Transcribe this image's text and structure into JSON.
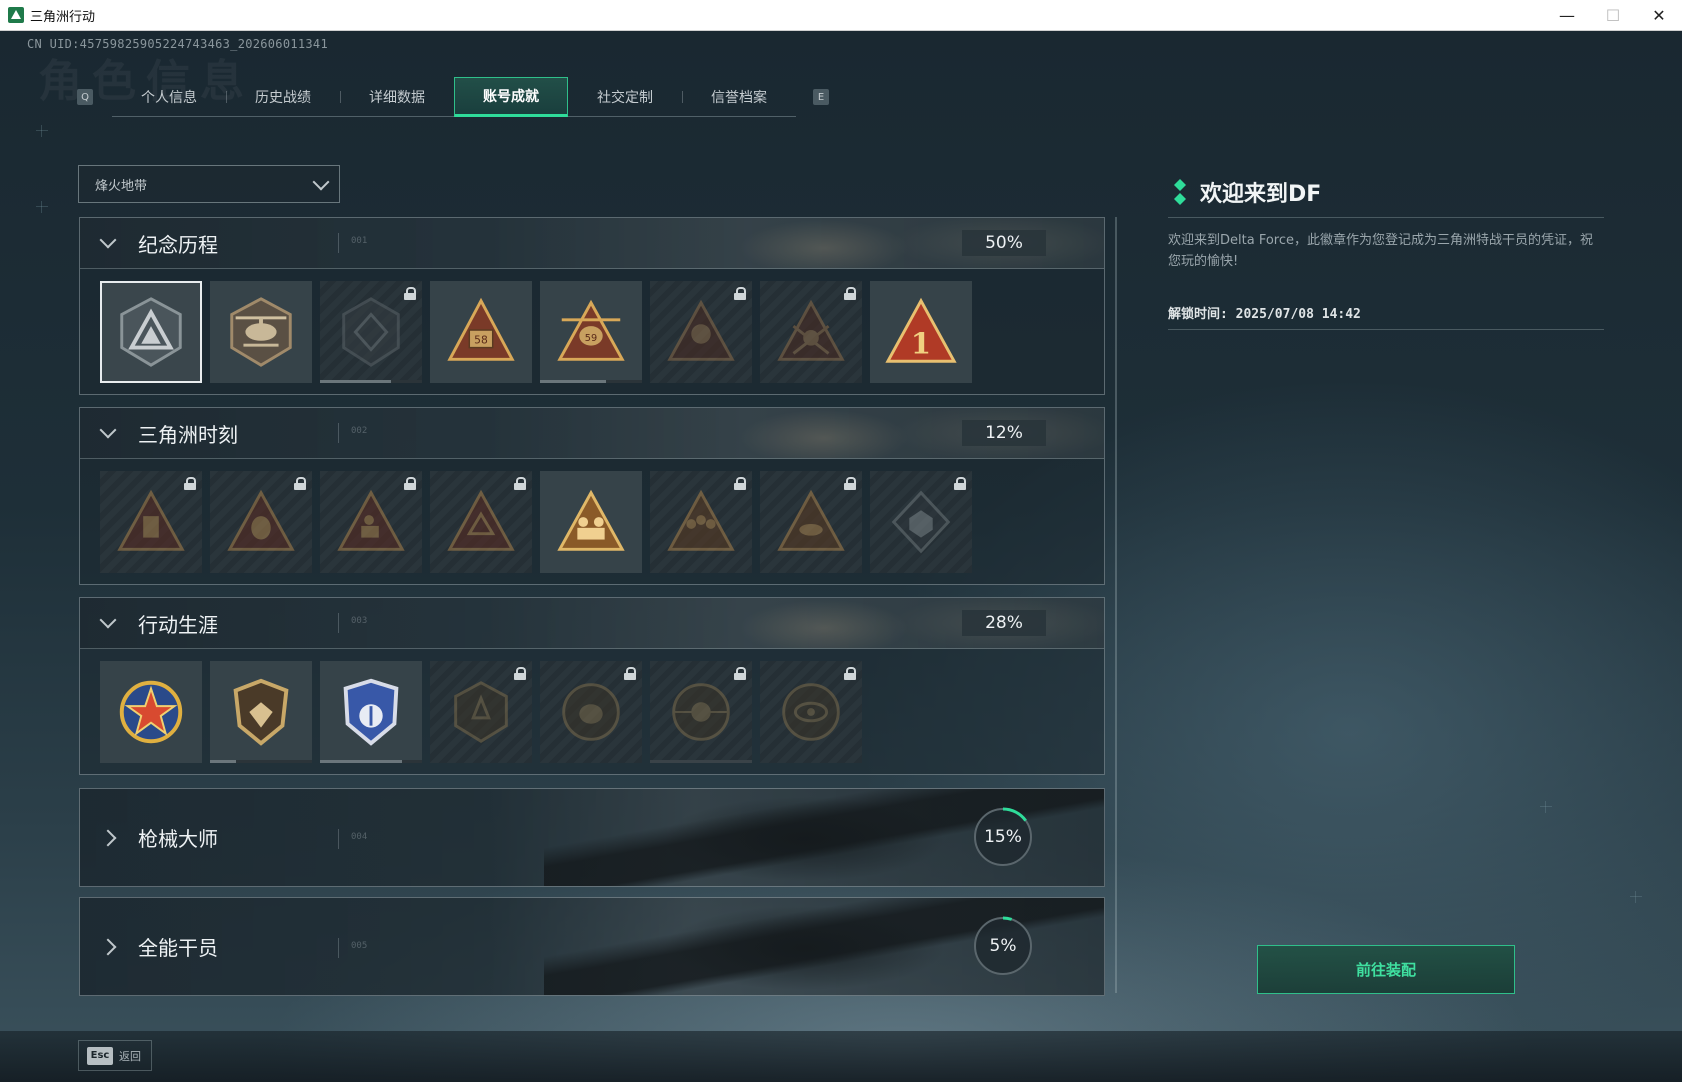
{
  "window": {
    "title": "三角洲行动",
    "minimize": "—",
    "maximize": "☐",
    "close": "✕"
  },
  "uid": "CN UID:457598259052247434​63_202606011341",
  "tabs": {
    "key_left": "Q",
    "key_right": "E",
    "items": [
      {
        "label": "个人信息",
        "active": false
      },
      {
        "label": "历史战绩",
        "active": false
      },
      {
        "label": "详细数据",
        "active": false
      },
      {
        "label": "账号成就",
        "active": true
      },
      {
        "label": "社交定制",
        "active": false
      },
      {
        "label": "信誉档案",
        "active": false
      }
    ]
  },
  "mode_select": {
    "value": "烽火地带"
  },
  "sections": [
    {
      "title": "纪念历程",
      "num": "001",
      "percent": "50%"
    },
    {
      "title": "三角洲时刻",
      "num": "002",
      "percent": "12%"
    },
    {
      "title": "行动生涯",
      "num": "003",
      "percent": "28%"
    }
  ],
  "cards": [
    {
      "title": "枪械大师",
      "num": "004",
      "percent": "15%",
      "progress": 0.15
    },
    {
      "title": "全能干员",
      "num": "005",
      "percent": "5%",
      "progress": 0.05
    }
  ],
  "badge_labels": {
    "b58": "58",
    "b59": "59",
    "b1": "1"
  },
  "info": {
    "title": "欢迎来到DF",
    "description": "欢迎来到Delta Force，此徽章作为您登记成为三角洲特战干员的凭证，祝您玩的愉快!",
    "unlock_time": "解锁时间: 2025/07/08 14:42"
  },
  "equip_button": "前往装配",
  "footer": {
    "esc_key": "Esc",
    "back_label": "返回"
  },
  "colors": {
    "accent": "#2fdc9a",
    "button_text": "#3fe0a0"
  }
}
